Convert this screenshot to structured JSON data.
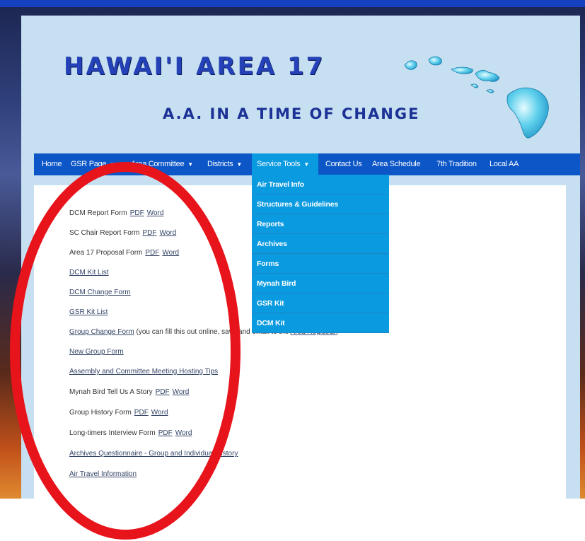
{
  "header": {
    "title": "HAWAI'I AREA 17",
    "subtitle": "A.A. IN A TIME OF CHANGE"
  },
  "nav": {
    "items": [
      {
        "label": "Home",
        "has_caret": false
      },
      {
        "label": "GSR Page",
        "has_caret": true
      },
      {
        "label": "Area Committee",
        "has_caret": true
      },
      {
        "label": "Districts",
        "has_caret": true
      },
      {
        "label": "Service Tools",
        "has_caret": true,
        "active": true
      },
      {
        "label": "Contact Us",
        "has_caret": false
      },
      {
        "label": "Area Schedule",
        "has_caret": false
      },
      {
        "label": "7th Tradition",
        "has_caret": false
      },
      {
        "label": "Local AA",
        "has_caret": false
      }
    ],
    "caret_glyph": "▼"
  },
  "dropdown": {
    "items": [
      "Air Travel Info",
      "Structures & Guidelines",
      "Reports",
      "Archives",
      "Forms",
      "Mynah Bird",
      "GSR Kit",
      "DCM Kit"
    ]
  },
  "content": {
    "rows": [
      {
        "text": "DCM Report Form",
        "pdf": "PDF",
        "word": "Word"
      },
      {
        "text": "SC Chair Report Form",
        "pdf": "PDF",
        "word": "Word"
      },
      {
        "text": "Area 17 Proposal Form",
        "pdf": "PDF",
        "word": "Word"
      },
      {
        "link": "DCM Kit List"
      },
      {
        "link": "DCM Change Form"
      },
      {
        "link": "GSR Kit List"
      },
      {
        "link": "Group Change Form",
        "after": "(you can fill this out online, save and email to the",
        "link2": "Area Registrar",
        "close": ")"
      },
      {
        "link": "New Group Form"
      },
      {
        "link": "Assembly and Committee Meeting Hosting Tips"
      },
      {
        "text": "Mynah Bird Tell Us A Story",
        "pdf": "PDF",
        "word": "Word"
      },
      {
        "text": "Group History Form",
        "pdf": "PDF",
        "word": "Word"
      },
      {
        "text": "Long-timers Interview Form",
        "pdf": "PDF",
        "word": "Word"
      },
      {
        "link": "Archives Questionnaire - Group and Individual History"
      },
      {
        "link": "Air Travel Information"
      }
    ]
  },
  "colors": {
    "nav_bg": "#0c56c7",
    "dropdown_bg": "#0a9ae0",
    "header_bg": "#c6dff1",
    "title_color": "#2441b8",
    "annotation_red": "#e8141b"
  }
}
